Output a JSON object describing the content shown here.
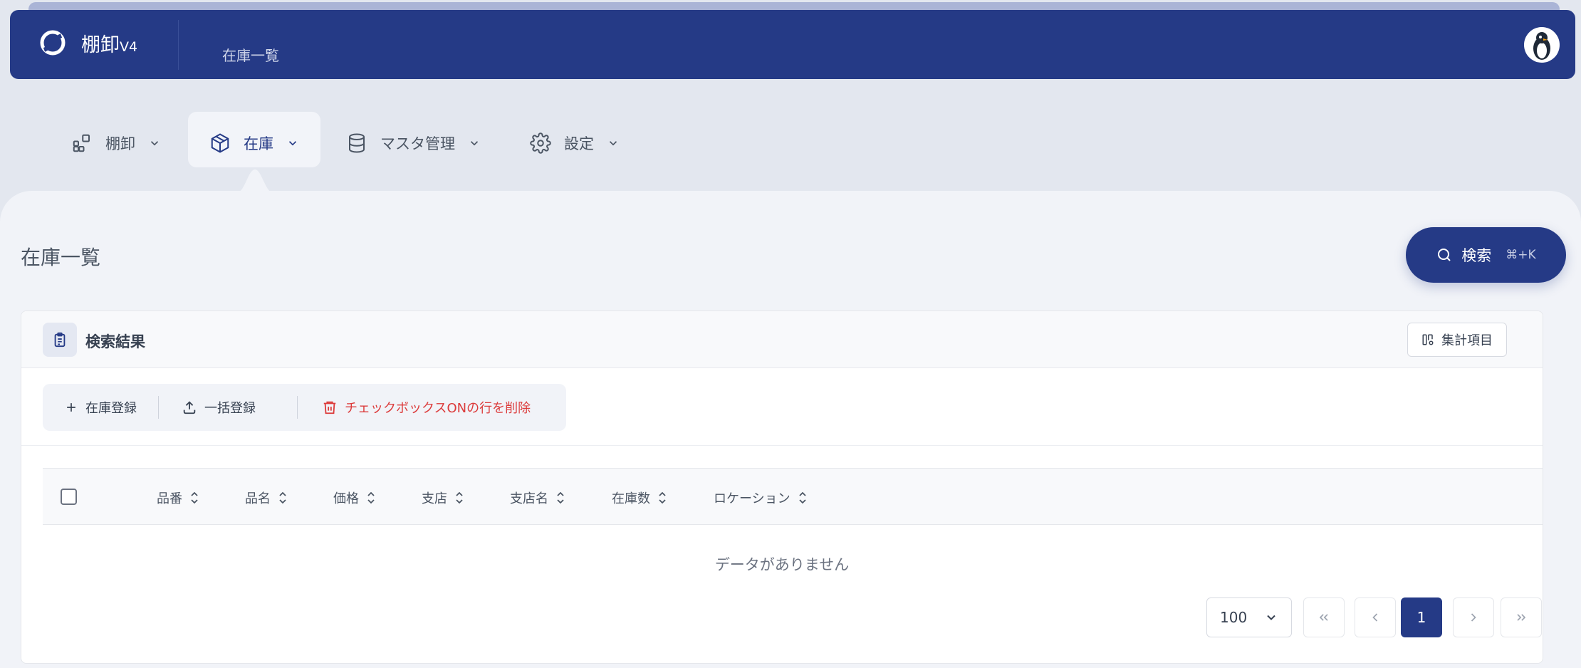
{
  "header": {
    "app_name": "棚卸",
    "app_version": "V4",
    "current_page": "在庫一覧"
  },
  "nav": {
    "items": [
      {
        "label": "棚卸",
        "icon": "blocks-icon"
      },
      {
        "label": "在庫",
        "icon": "box-icon",
        "active": true
      },
      {
        "label": "マスタ管理",
        "icon": "database-icon"
      },
      {
        "label": "設定",
        "icon": "gear-icon"
      }
    ]
  },
  "page": {
    "title": "在庫一覧",
    "search_label": "検索",
    "search_shortcut": "⌘+K"
  },
  "card": {
    "title": "検索結果",
    "aggregate_label": "集計項目"
  },
  "toolbar": {
    "add_label": "在庫登録",
    "bulk_label": "一括登録",
    "delete_label": "チェックボックスONの行を削除"
  },
  "table": {
    "columns": [
      "品番",
      "品名",
      "価格",
      "支店",
      "支店名",
      "在庫数",
      "ロケーション"
    ],
    "empty_message": "データがありません"
  },
  "pagination": {
    "per_page": "100",
    "current_page": "1"
  },
  "colors": {
    "primary": "#253a86",
    "danger": "#dc3b3b",
    "background": "#e3e7ef"
  }
}
